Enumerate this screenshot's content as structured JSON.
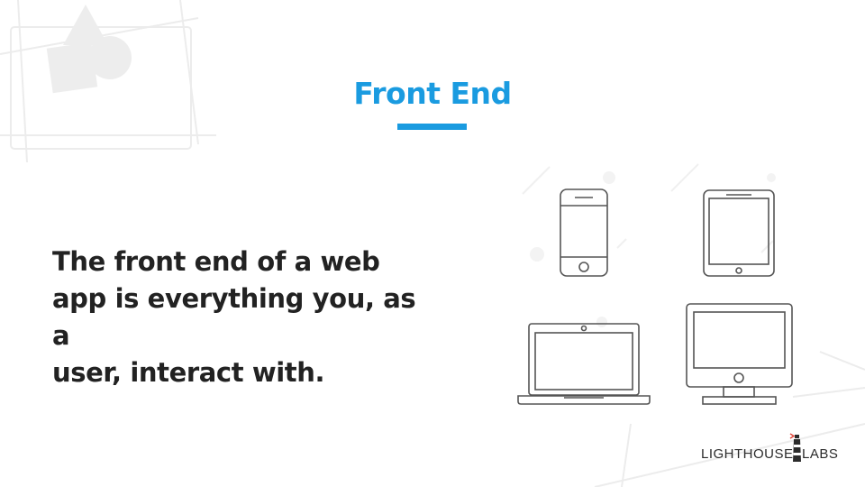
{
  "slide": {
    "title": "Front End",
    "body_lines": [
      "The front end of a web",
      "app is everything you, as a",
      "user, interact with."
    ]
  },
  "logo": {
    "word_left": "LIGHTHOUSE",
    "word_right": "LABS"
  },
  "colors": {
    "accent": "#1a9be0",
    "text": "#222222",
    "logo_red": "#e0453a"
  },
  "icons": [
    "smartphone-icon",
    "tablet-icon",
    "laptop-icon",
    "desktop-monitor-icon",
    "lighthouse-icon"
  ]
}
